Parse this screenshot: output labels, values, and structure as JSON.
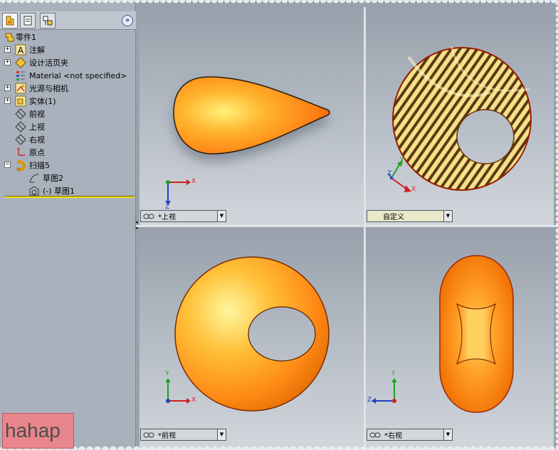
{
  "feature_tree": {
    "root": "零件1",
    "items": [
      {
        "label": "注解",
        "icon": "annotation-icon",
        "expandable": true
      },
      {
        "label": "设计活页夹",
        "icon": "design-binder-icon",
        "expandable": true
      },
      {
        "label": "Material <not specified>",
        "icon": "material-icon",
        "expandable": false
      },
      {
        "label": "光源与相机",
        "icon": "lights-cameras-icon",
        "expandable": true
      },
      {
        "label": "实体(1)",
        "icon": "solid-bodies-icon",
        "expandable": true
      },
      {
        "label": "前视",
        "icon": "plane-icon",
        "expandable": false
      },
      {
        "label": "上视",
        "icon": "plane-icon",
        "expandable": false
      },
      {
        "label": "右视",
        "icon": "plane-icon",
        "expandable": false
      },
      {
        "label": "原点",
        "icon": "origin-icon",
        "expandable": false
      },
      {
        "label": "扫描5",
        "icon": "sweep-icon",
        "expandable": true,
        "expanded": true
      },
      {
        "label": "草图2",
        "icon": "sketch-icon",
        "child": true
      },
      {
        "label": "(-) 草图1",
        "icon": "sketch-icon",
        "child": true
      }
    ],
    "collapse_glyph": "»"
  },
  "viewports": {
    "top_left": {
      "label": "*上视"
    },
    "top_right": {
      "label": "自定义"
    },
    "bottom_left": {
      "label": "*前视"
    },
    "bottom_right": {
      "label": "*右视"
    }
  },
  "axes": {
    "x": "X",
    "y": "Y",
    "z": "Z"
  },
  "colors": {
    "body_orange": "#ff8c1a",
    "body_highlight": "#fff27a",
    "rollback_bar": "#f2e300",
    "watermark_bg": "#e8868c"
  },
  "watermark": "hahap"
}
